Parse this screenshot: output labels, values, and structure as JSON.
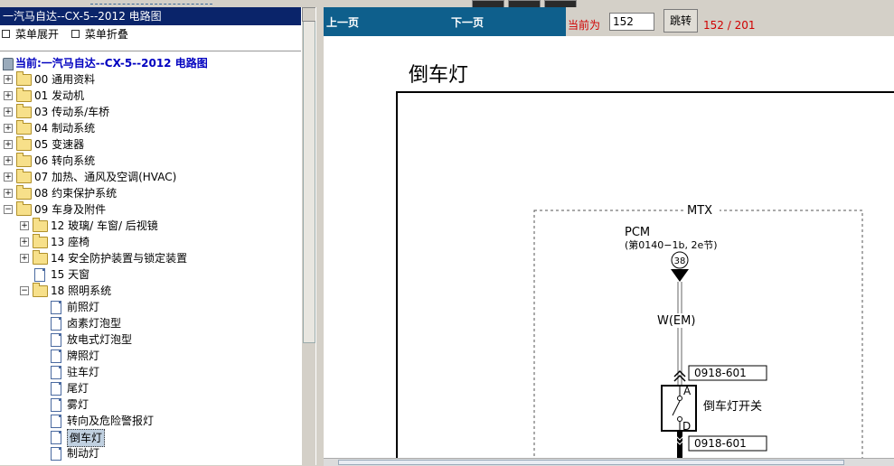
{
  "panel_title": "一汽马自达--CX-5--2012 电路图",
  "menu": {
    "expand": "菜单展开",
    "collapse": "菜单折叠"
  },
  "tree": {
    "current": "当前:一汽马自达--CX-5--2012 电路图",
    "items": [
      "00 通用资料",
      "01 发动机",
      "03 传动系/车桥",
      "04 制动系统",
      "05 变速器",
      "06 转向系统",
      "07 加热、通风及空调(HVAC)",
      "08 约束保护系统",
      "09 车身及附件"
    ],
    "sub09": [
      "12 玻璃/ 车窗/ 后视镜",
      "13 座椅",
      "14 安全防护装置与锁定装置",
      "15 天窗",
      "18 照明系统"
    ],
    "sub18": [
      "前照灯",
      "卤素灯泡型",
      "放电式灯泡型",
      "牌照灯",
      "驻车灯",
      "尾灯",
      "雾灯",
      "转向及危险警报灯",
      "倒车灯",
      "制动灯"
    ],
    "selected_index": 8
  },
  "toolbar": {
    "prev": "上一页",
    "next": "下一页",
    "current_label": "当前为",
    "current_value": "152",
    "jump": "跳转",
    "page_count": "152 / 201"
  },
  "diagram": {
    "title": "倒车灯",
    "mtx": "MTX",
    "pcm": "PCM",
    "pcm_ref": "(第0140−1b, 2e节)",
    "pin": "38",
    "wire": "W(EM)",
    "conn1": "0918-601",
    "conn2": "0918-601",
    "switch_a": "A",
    "switch_d": "D",
    "switch_label": "倒车灯开关"
  },
  "colors": {
    "title_bar": "#0a246a",
    "toolbar": "#0e5f8c",
    "red_text": "#d00000"
  }
}
